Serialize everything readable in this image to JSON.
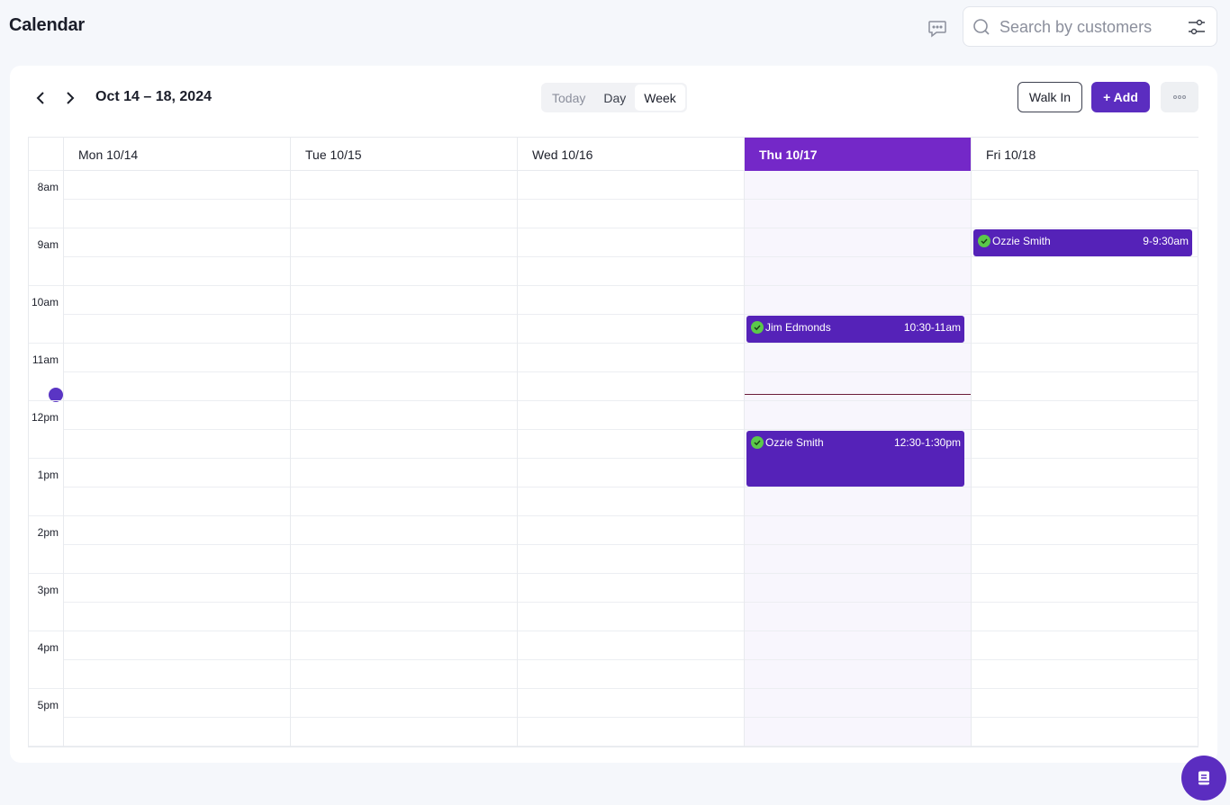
{
  "page": {
    "title": "Calendar"
  },
  "header": {
    "search": {
      "placeholder": "Search by customers",
      "value": ""
    },
    "icons": {
      "chat": "chat-bubble-icon",
      "search": "search-icon",
      "filter": "sliders-icon"
    }
  },
  "toolbar": {
    "range_title": "Oct 14 – 18, 2024",
    "views": [
      {
        "label": "Today",
        "state": "muted"
      },
      {
        "label": "Day",
        "state": "normal"
      },
      {
        "label": "Week",
        "state": "active"
      }
    ],
    "walk_in_label": "Walk In",
    "add_label": "+ Add"
  },
  "calendar": {
    "days": [
      {
        "label": "Mon 10/14",
        "is_today": false
      },
      {
        "label": "Tue 10/15",
        "is_today": false
      },
      {
        "label": "Wed 10/16",
        "is_today": false
      },
      {
        "label": "Thu 10/17",
        "is_today": true
      },
      {
        "label": "Fri 10/18",
        "is_today": false
      }
    ],
    "hours": [
      "8am",
      "9am",
      "10am",
      "11am",
      "12pm",
      "1pm",
      "2pm",
      "3pm",
      "4pm",
      "5pm"
    ],
    "events": [
      {
        "day": "Fri 10/18",
        "name": "Ozzie Smith",
        "time": "9-9:30am",
        "confirmed": true
      },
      {
        "day": "Thu 10/17",
        "name": "Jim Edmonds",
        "time": "10:30-11am",
        "confirmed": true
      },
      {
        "day": "Thu 10/17",
        "name": "Ozzie Smith",
        "time": "12:30-1:30pm",
        "confirmed": true
      }
    ]
  },
  "colors": {
    "accent": "#5b2dc0",
    "today_header": "#7428c8",
    "event": "#5522b8",
    "confirmed": "#5bc94a"
  }
}
